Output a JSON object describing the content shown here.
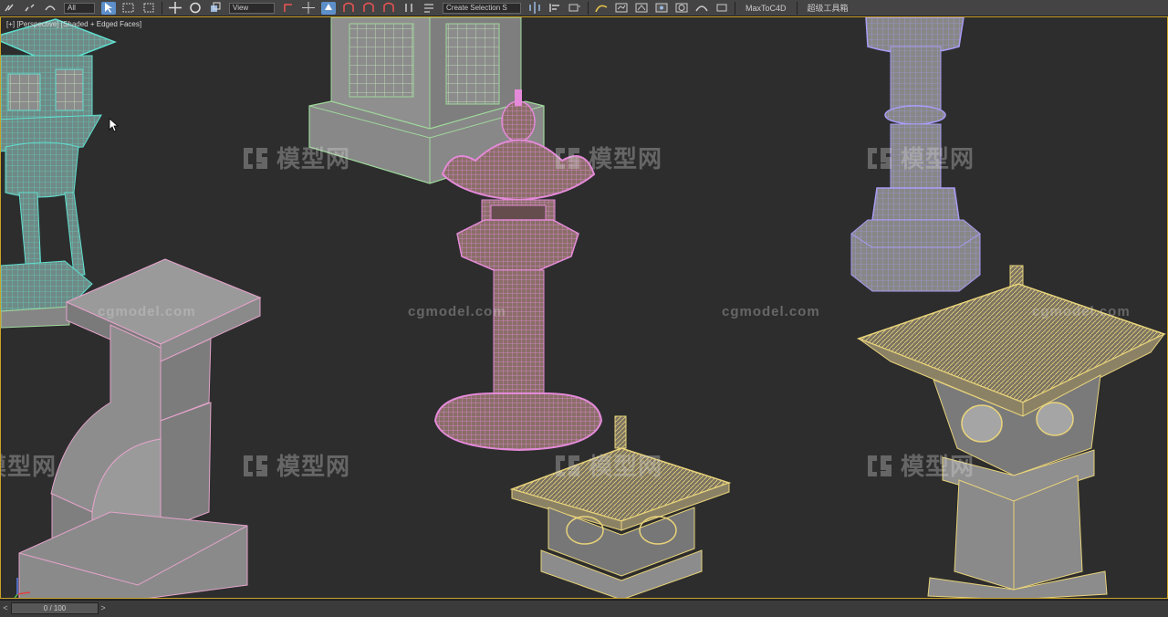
{
  "toolbar": {
    "dropdown_all": "All",
    "dropdown_view": "View",
    "dropdown_selection": "Create Selection S",
    "maxtoc4d_label": "MaxToC4D",
    "chaoji_label": "超级工具箱"
  },
  "viewport": {
    "label": "[+] [Perspective] [Shaded + Edged Faces]",
    "border_color": "#c9a227",
    "background": "#2d2d2d"
  },
  "watermarks": {
    "cn_text": "模型网",
    "en_text": "cgmodel.com"
  },
  "timeline": {
    "frame_label": "0 / 100",
    "prev": "<",
    "next": ">"
  },
  "object_colors": {
    "cyan_wire": "#5fe0d0",
    "pink_wire": "#e48ad9",
    "purple_wire": "#a89cf5",
    "yellow_wire": "#e8d37a",
    "pink_outline": "#e3a3c9",
    "green_outline": "#9fd89b"
  }
}
